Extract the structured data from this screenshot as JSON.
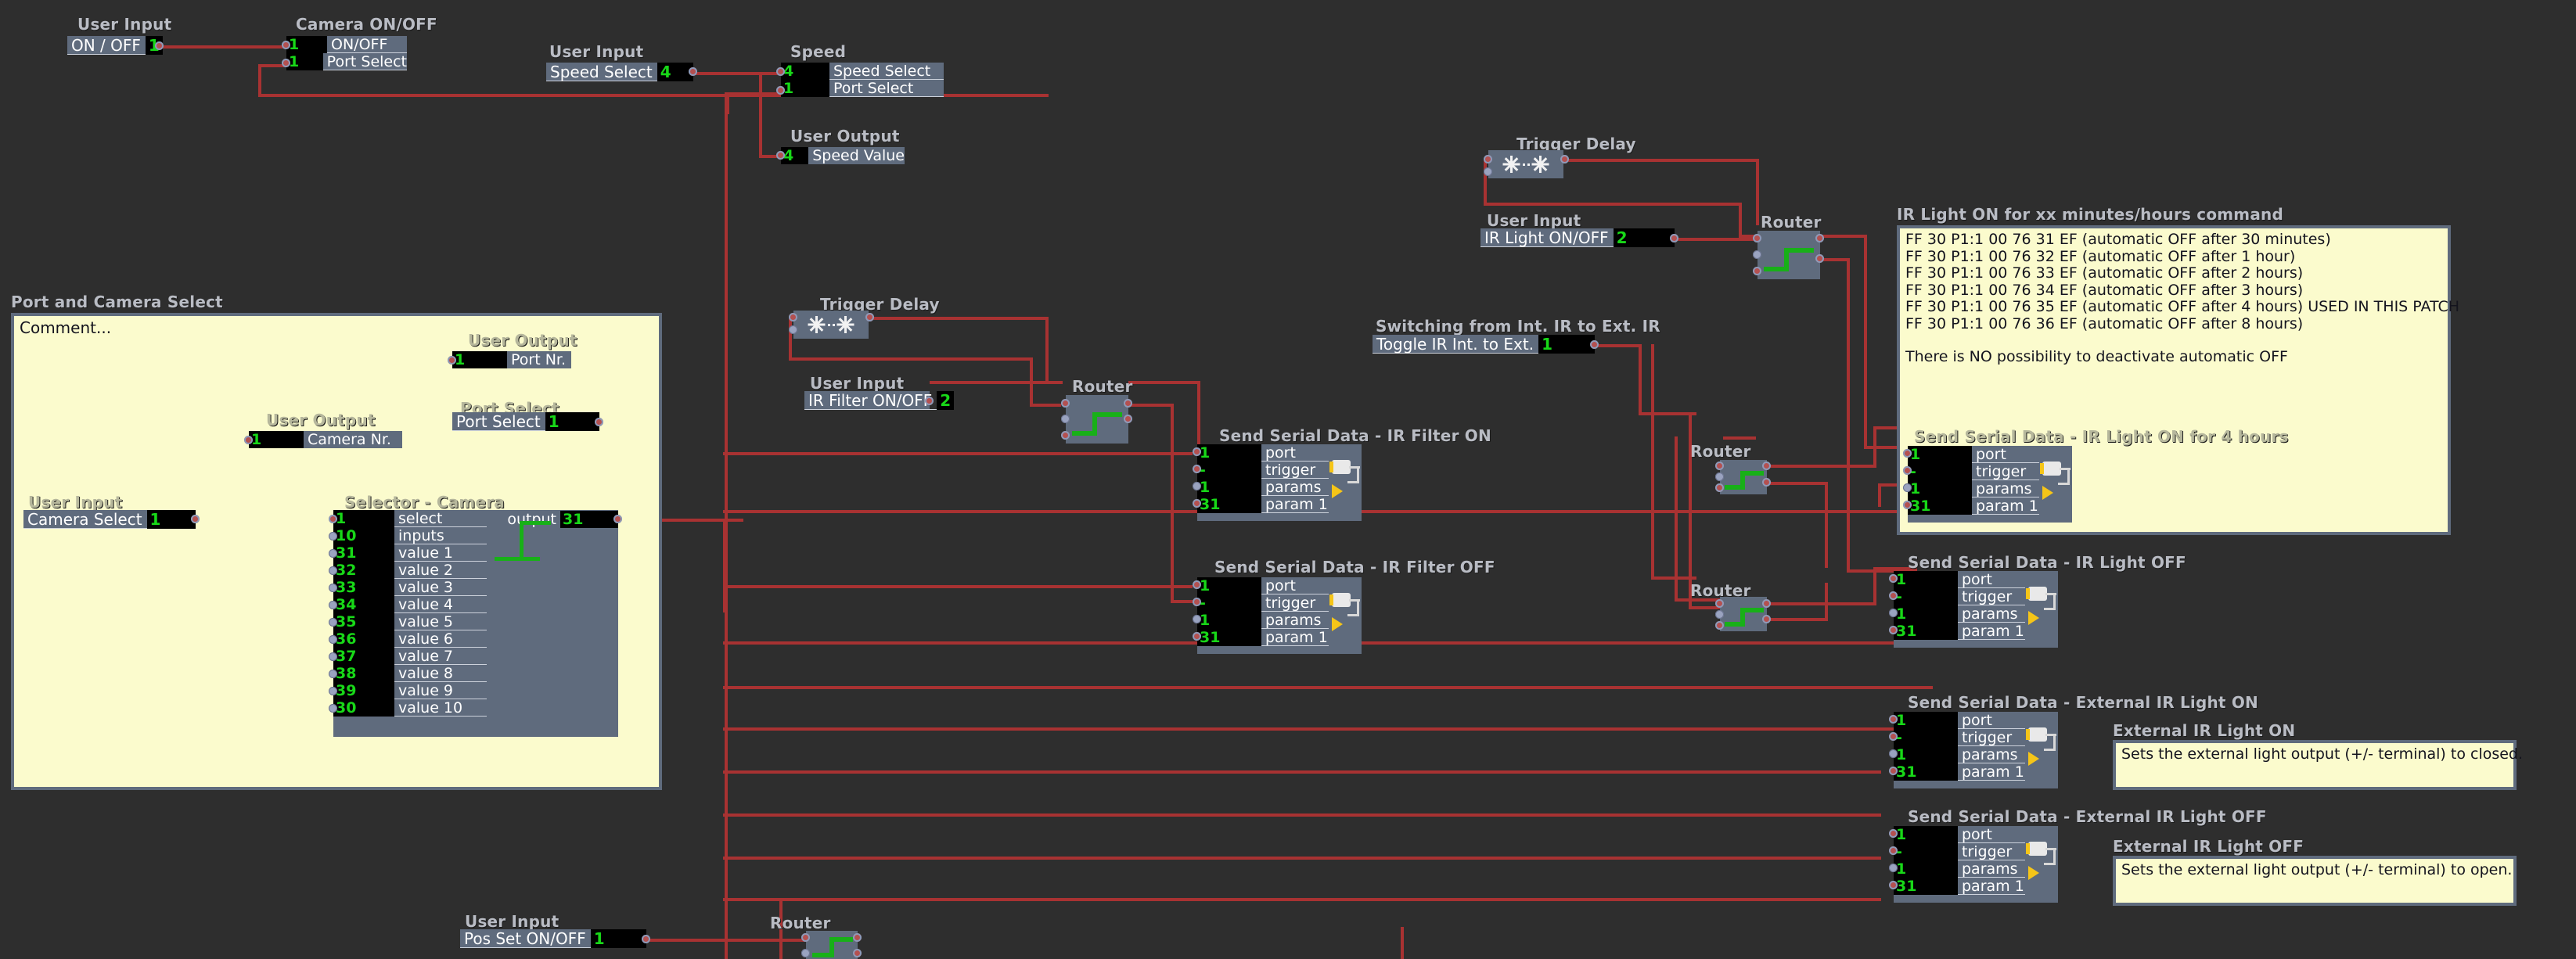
{
  "app": {
    "background_color": "#2e2e2e",
    "wire_color": "#a83232",
    "signal_green": "#18d818",
    "node_body_color": "#5f6b7d",
    "comment_yellow": "#fbfbcd"
  },
  "nodes": {
    "user_input_onoff": {
      "title": "User Input",
      "label": "ON / OFF",
      "value": "1"
    },
    "camera_onoff": {
      "title": "Camera ON/OFF",
      "rows": [
        {
          "value": "1",
          "label": "ON/OFF"
        },
        {
          "value": "1",
          "label": "Port Select"
        }
      ]
    },
    "user_input_speed_select": {
      "title": "User Input",
      "label": "Speed Select",
      "value": "4"
    },
    "speed": {
      "title": "Speed",
      "rows": [
        {
          "value": "4",
          "label": "Speed Select"
        },
        {
          "value": "1",
          "label": "Port Select"
        }
      ]
    },
    "user_output_speed_value": {
      "title": "User Output",
      "rows": [
        {
          "value": "4",
          "label": "Speed Value"
        }
      ]
    },
    "port_camera_select_group": {
      "title": "Port and Camera Select",
      "comment": "Comment...",
      "user_output_port_nr": {
        "title": "User Output",
        "rows": [
          {
            "value": "1",
            "label": "Port Nr."
          }
        ]
      },
      "user_output_camera_nr": {
        "title": "User Output",
        "rows": [
          {
            "value": "1",
            "label": "Camera Nr."
          }
        ]
      },
      "port_select": {
        "title": "Port Select",
        "label": "Port Select",
        "value": "1"
      },
      "user_input_camera_select": {
        "title": "User Input",
        "label": "Camera Select",
        "value": "1"
      },
      "selector_camera": {
        "title": "Selector - Camera",
        "output_label": "output",
        "output_value": "31",
        "rows": [
          {
            "value": "1",
            "label": "select"
          },
          {
            "value": "10",
            "label": "inputs"
          },
          {
            "value": "31",
            "label": "value 1"
          },
          {
            "value": "32",
            "label": "value 2"
          },
          {
            "value": "33",
            "label": "value 3"
          },
          {
            "value": "34",
            "label": "value 4"
          },
          {
            "value": "35",
            "label": "value 5"
          },
          {
            "value": "36",
            "label": "value 6"
          },
          {
            "value": "37",
            "label": "value 7"
          },
          {
            "value": "38",
            "label": "value 8"
          },
          {
            "value": "39",
            "label": "value 9"
          },
          {
            "value": "30",
            "label": "value 10"
          }
        ]
      }
    },
    "trigger_delay_left": {
      "title": "Trigger Delay",
      "icon": "snowflake-pair-icon"
    },
    "trigger_delay_right": {
      "title": "Trigger Delay",
      "icon": "snowflake-pair-icon"
    },
    "user_input_ir_filter": {
      "title": "User Input",
      "label": "IR Filter ON/OFF",
      "value": "2"
    },
    "router_ir_filter": {
      "title": "Router"
    },
    "user_input_ir_light": {
      "title": "User Input",
      "label": "IR Light ON/OFF",
      "value": "2"
    },
    "router_ir_light": {
      "title": "Router"
    },
    "toggle_int_ext": {
      "title": "Switching from Int. IR to Ext. IR",
      "label": "Toggle IR Int. to Ext.",
      "value": "1"
    },
    "router_mid_upper": {
      "title": "Router"
    },
    "router_mid_lower": {
      "title": "Router"
    },
    "router_bottom": {
      "title": "Router"
    },
    "user_input_pos_set": {
      "title": "User Input",
      "label": "Pos Set ON/OFF",
      "value": "1"
    },
    "serial_ir_filter_on": {
      "title": "Send Serial Data - IR Filter ON",
      "rows": [
        {
          "value": "1",
          "label": "port"
        },
        {
          "value": "-",
          "label": "trigger"
        },
        {
          "value": "1",
          "label": "params"
        },
        {
          "value": "31",
          "label": "param 1"
        }
      ]
    },
    "serial_ir_filter_off": {
      "title": "Send Serial Data - IR Filter OFF",
      "rows": [
        {
          "value": "1",
          "label": "port"
        },
        {
          "value": "-",
          "label": "trigger"
        },
        {
          "value": "1",
          "label": "params"
        },
        {
          "value": "31",
          "label": "param 1"
        }
      ]
    },
    "serial_ir_light_on_4h": {
      "title": "Send Serial Data - IR Light ON for 4 hours",
      "rows": [
        {
          "value": "1",
          "label": "port"
        },
        {
          "value": "-",
          "label": "trigger"
        },
        {
          "value": "1",
          "label": "params"
        },
        {
          "value": "31",
          "label": "param 1"
        }
      ]
    },
    "serial_ir_light_off": {
      "title": "Send Serial Data - IR Light OFF",
      "rows": [
        {
          "value": "1",
          "label": "port"
        },
        {
          "value": "-",
          "label": "trigger"
        },
        {
          "value": "1",
          "label": "params"
        },
        {
          "value": "31",
          "label": "param 1"
        }
      ]
    },
    "serial_ext_light_on": {
      "title": "Send Serial Data - External IR Light ON",
      "rows": [
        {
          "value": "1",
          "label": "port"
        },
        {
          "value": "-",
          "label": "trigger"
        },
        {
          "value": "1",
          "label": "params"
        },
        {
          "value": "31",
          "label": "param 1"
        }
      ]
    },
    "serial_ext_light_off": {
      "title": "Send Serial Data - External IR Light OFF",
      "rows": [
        {
          "value": "1",
          "label": "port"
        },
        {
          "value": "-",
          "label": "trigger"
        },
        {
          "value": "1",
          "label": "params"
        },
        {
          "value": "31",
          "label": "param 1"
        }
      ]
    }
  },
  "comments": {
    "ir_light_command": {
      "title": "IR Light ON for xx minutes/hours command",
      "lines": [
        "FF 30 P1:1 00 76 31 EF (automatic OFF after 30 minutes)",
        "FF 30 P1:1 00 76 32 EF (automatic OFF after 1 hour)",
        "FF 30 P1:1 00 76 33 EF (automatic OFF after 2 hours)",
        "FF 30 P1:1 00 76 34 EF (automatic OFF after 3 hours)",
        "FF 30 P1:1 00 76 35 EF (automatic OFF after 4 hours) USED IN THIS PATCH",
        "FF 30 P1:1 00 76 36 EF (automatic OFF after 8 hours)",
        "",
        "There is NO possibility to deactivate automatic OFF"
      ]
    },
    "external_ir_light_on": {
      "title": "External IR Light ON",
      "text": "Sets the external light output (+/- terminal) to closed."
    },
    "external_ir_light_off": {
      "title": "External IR Light OFF",
      "text": "Sets the external light output (+/- terminal) to open."
    }
  }
}
